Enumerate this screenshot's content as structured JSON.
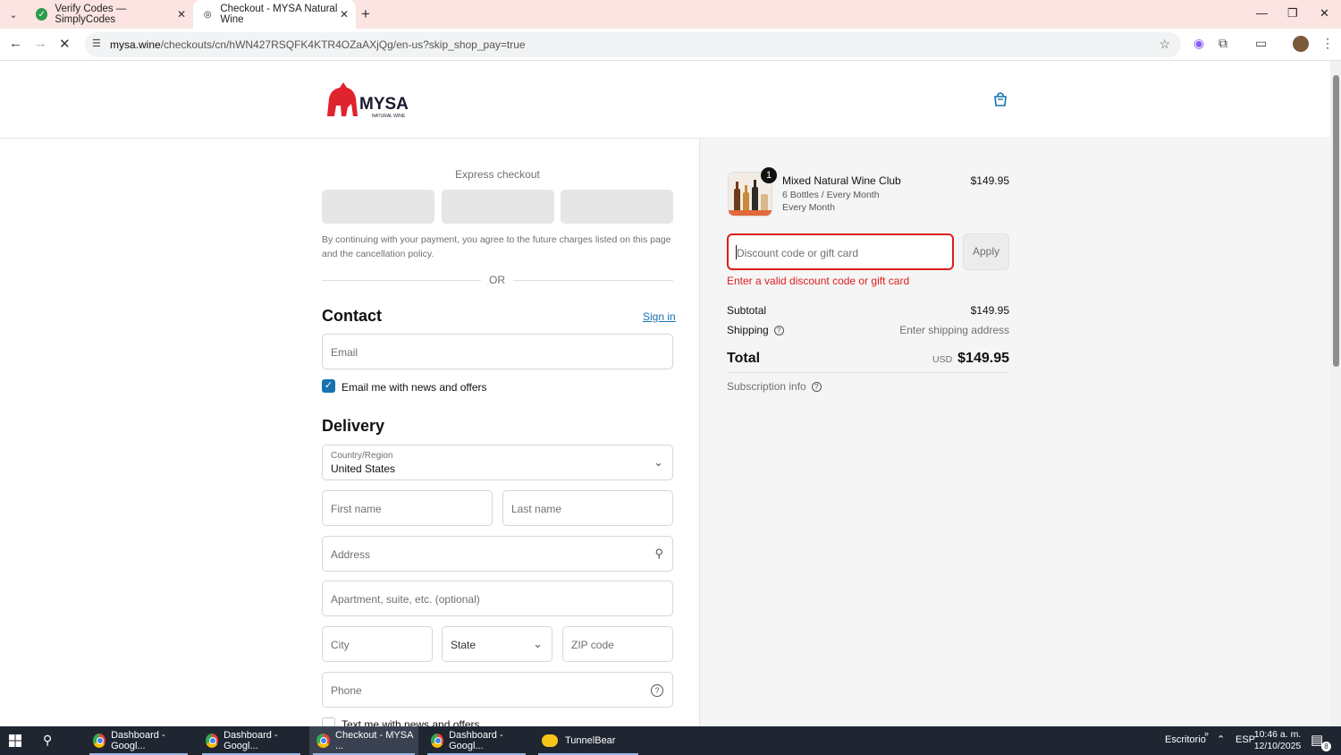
{
  "browser": {
    "tabs": [
      {
        "title": "Verify Codes — SimplyCodes",
        "active": false
      },
      {
        "title": "Checkout - MYSA Natural Wine",
        "active": true
      }
    ],
    "url_host": "mysa.wine",
    "url_path": "/checkouts/cn/hWN427RSQFK4KTR4OZaAXjQg/en-us?skip_shop_pay=true"
  },
  "header": {
    "logo_text": "MYSA",
    "logo_sub": "NATURAL WINE"
  },
  "checkout": {
    "express_title": "Express checkout",
    "legal": "By continuing with your payment, you agree to the future charges listed on this page and the cancellation policy.",
    "or": "OR",
    "contact_title": "Contact",
    "sign_in": "Sign in",
    "email_placeholder": "Email",
    "email_news_label": "Email me with news and offers",
    "delivery_title": "Delivery",
    "country_label": "Country/Region",
    "country_value": "United States",
    "first_name": "First name",
    "last_name": "Last name",
    "address": "Address",
    "apartment": "Apartment, suite, etc. (optional)",
    "city": "City",
    "state": "State",
    "zip": "ZIP code",
    "phone": "Phone",
    "text_news_label": "Text me with news and offers"
  },
  "summary": {
    "quantity": "1",
    "product_name": "Mixed Natural Wine Club",
    "product_variant": "6 Bottles / Every Month",
    "product_frequency": "Every Month",
    "product_price": "$149.95",
    "discount_placeholder": "Discount code or gift card",
    "apply": "Apply",
    "error": "Enter a valid discount code or gift card",
    "subtotal_label": "Subtotal",
    "subtotal_value": "$149.95",
    "shipping_label": "Shipping",
    "shipping_value": "Enter shipping address",
    "total_label": "Total",
    "total_currency": "USD",
    "total_value": "$149.95",
    "subscription_info": "Subscription info"
  },
  "taskbar": {
    "items": [
      {
        "label": "Dashboard - Googl..."
      },
      {
        "label": "Dashboard - Googl..."
      },
      {
        "label": "Checkout - MYSA ..."
      },
      {
        "label": "Dashboard - Googl..."
      },
      {
        "label": "TunnelBear"
      }
    ],
    "desktop": "Escritorio",
    "lang": "ESP",
    "time": "10:46 a. m.",
    "date": "12/10/2025",
    "notifications": "8"
  },
  "colors": {
    "accent": "#1773b0",
    "error": "#dd1d1d",
    "brand": "#e0242d",
    "tabbar": "#fbe4e1"
  }
}
